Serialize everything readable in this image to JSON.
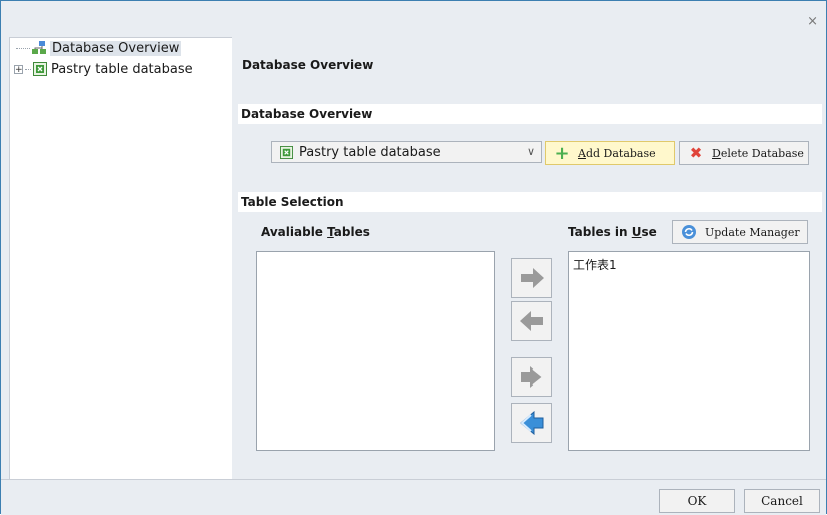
{
  "titlebar": {
    "close_glyph": "×"
  },
  "tree": {
    "items": [
      {
        "label": "Database Overview",
        "icon": "hierarchy-icon",
        "selected": true
      },
      {
        "label": "Pastry table database",
        "icon": "spreadsheet-icon",
        "expander": "+"
      }
    ]
  },
  "main": {
    "heading": "Database Overview",
    "overview_section": {
      "title": "Database Overview",
      "database_select_value": "Pastry table database",
      "add_button_prefix": "",
      "add_button_mnemonic": "A",
      "add_button_rest": "dd Database",
      "delete_button_mnemonic": "D",
      "delete_button_rest": "elete Database"
    },
    "table_section": {
      "title": "Table Selection",
      "available_label_prefix": "Avaliable ",
      "available_label_mnemonic": "T",
      "available_label_rest": "ables",
      "in_use_label_prefix": "Tables in ",
      "in_use_label_mnemonic": "U",
      "in_use_label_rest": "se",
      "update_button": "Update Manager",
      "available_tables": [],
      "tables_in_use": [
        "工作表1"
      ]
    }
  },
  "footer": {
    "ok": "OK",
    "cancel": "Cancel"
  },
  "colors": {
    "accent": "#3c7fb1",
    "add_button_bg": "#fff8cc",
    "arrow_gray": "#9a9a9a",
    "arrow_blue": "#3a8fd8"
  }
}
